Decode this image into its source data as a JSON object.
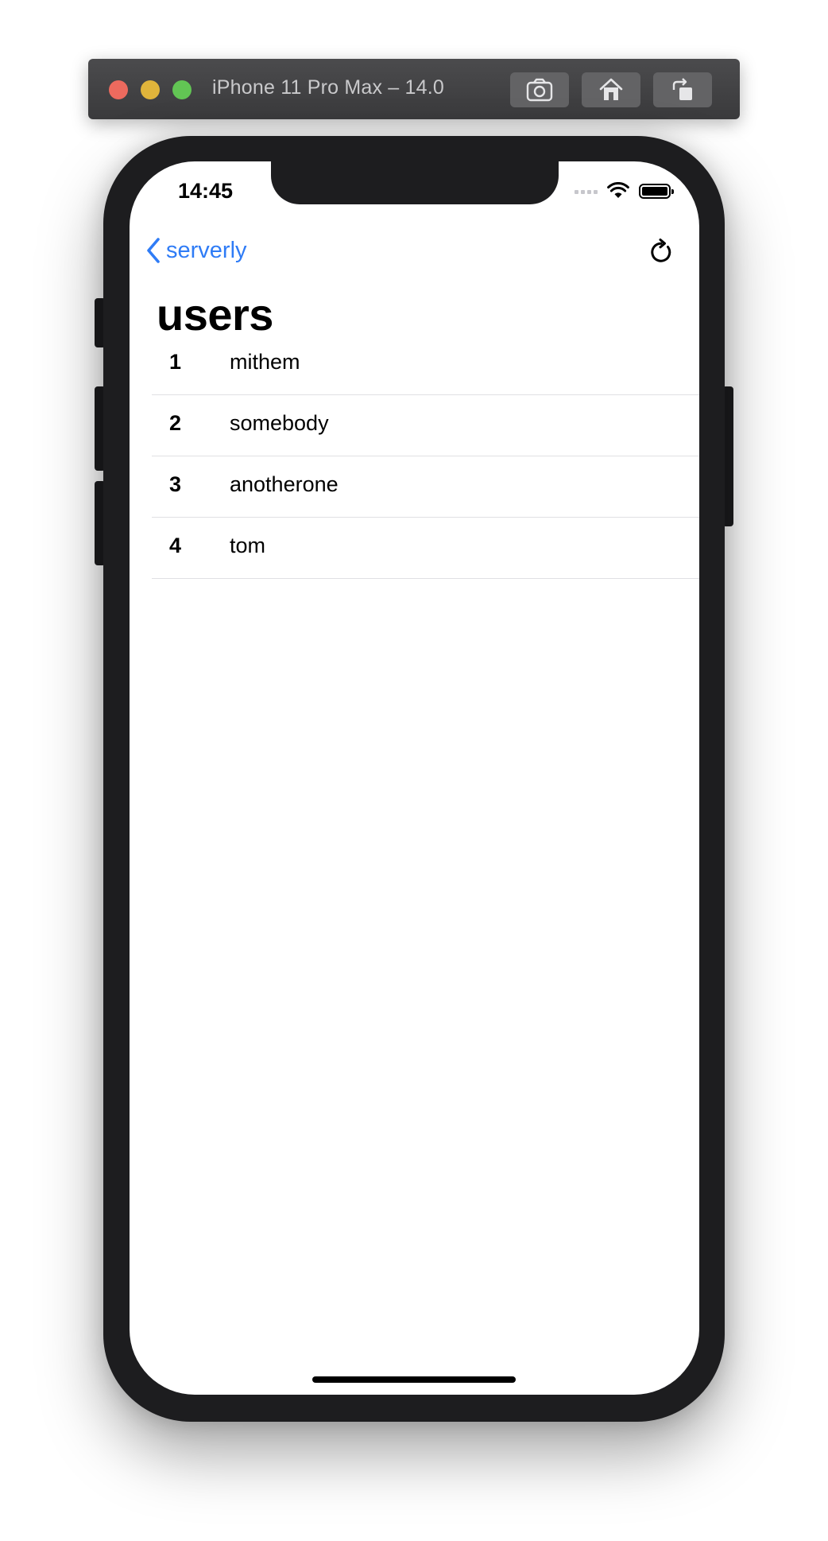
{
  "simulator": {
    "title": "iPhone 11 Pro Max – 14.0",
    "buttons": [
      "camera-icon",
      "home-icon",
      "rotate-icon"
    ]
  },
  "status_bar": {
    "time": "14:45"
  },
  "nav": {
    "back_label": "serverly",
    "title": "users",
    "accent_color": "#2f7cf6"
  },
  "users": [
    {
      "id": "1",
      "name": "mithem"
    },
    {
      "id": "2",
      "name": "somebody"
    },
    {
      "id": "3",
      "name": "anotherone"
    },
    {
      "id": "4",
      "name": "tom"
    }
  ]
}
